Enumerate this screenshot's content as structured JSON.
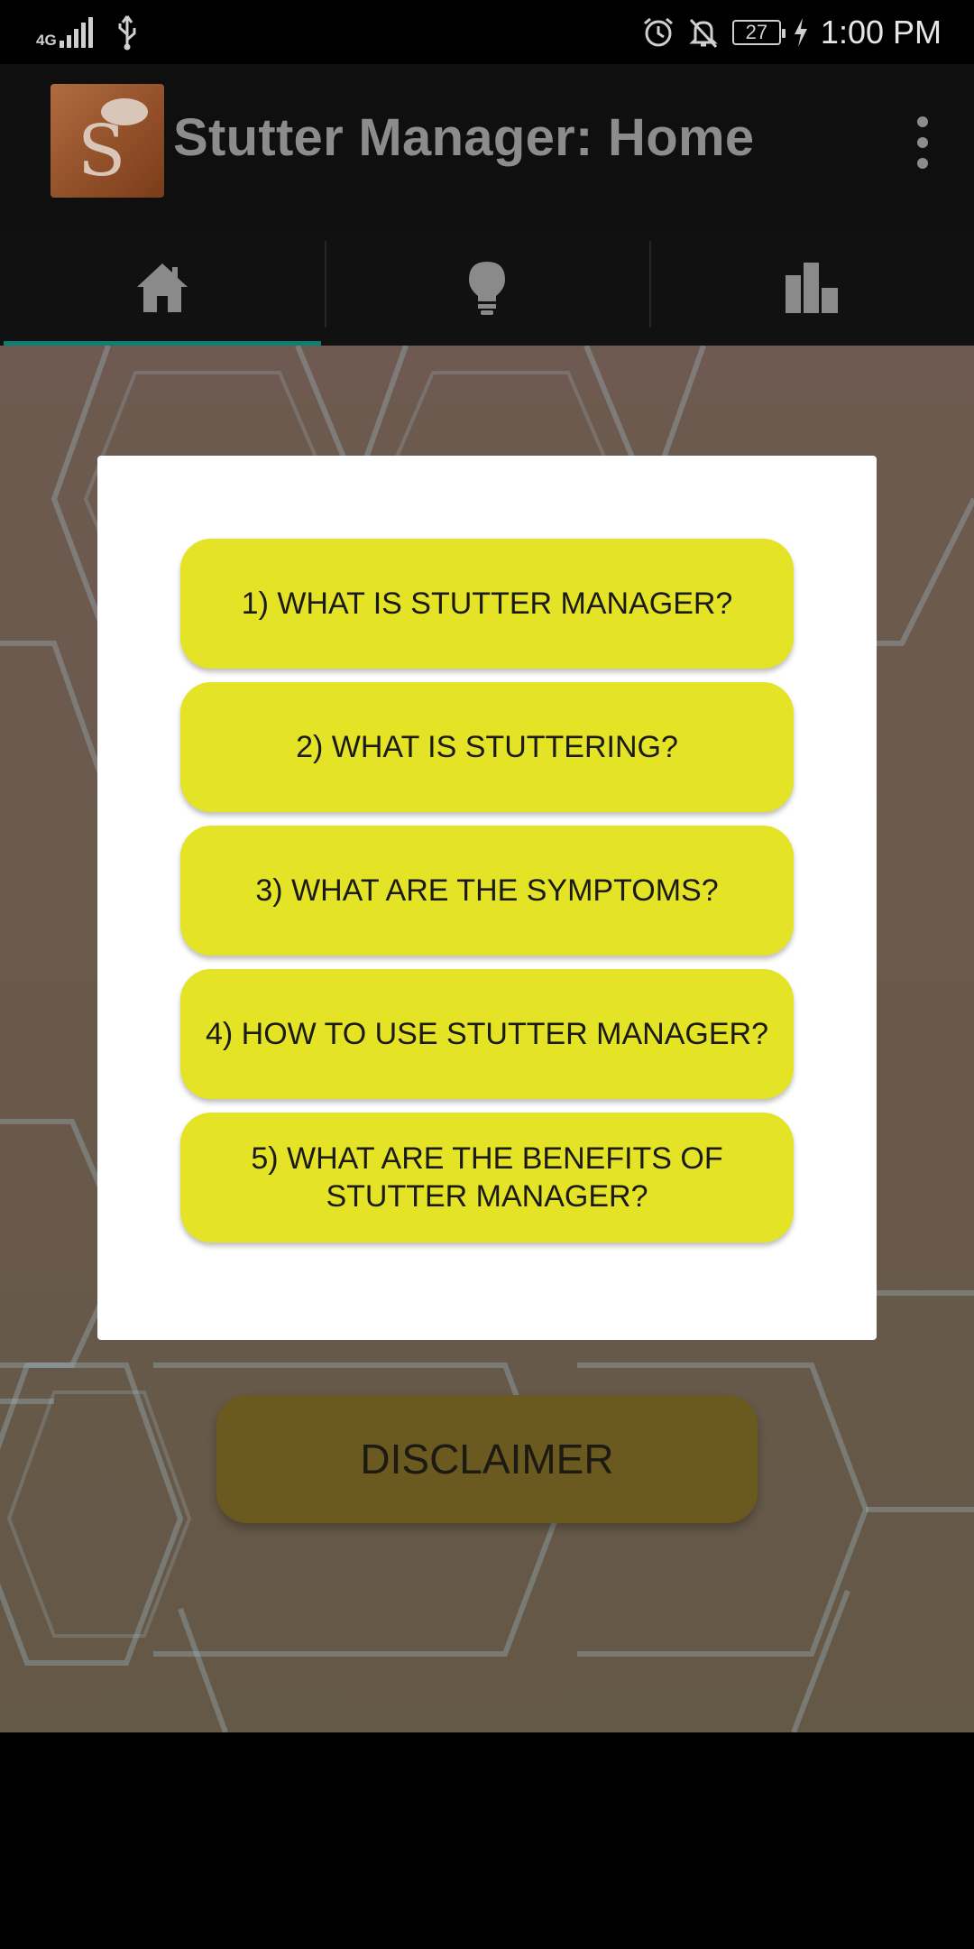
{
  "status_bar": {
    "network": "4G",
    "battery": "27",
    "time": "1:00 PM",
    "icons": [
      "signal-icon",
      "usb-icon",
      "alarm-icon",
      "bell-off-icon",
      "battery-icon",
      "charging-icon"
    ]
  },
  "app_bar": {
    "title": "Stutter Manager: Home",
    "logo_letter": "S"
  },
  "tabs": [
    {
      "icon": "home-icon",
      "active": true
    },
    {
      "icon": "lightbulb-icon",
      "active": false
    },
    {
      "icon": "bar-chart-icon",
      "active": false
    }
  ],
  "dialog": {
    "buttons": [
      "1) WHAT IS STUTTER MANAGER?",
      "2) WHAT IS STUTTERING?",
      "3) WHAT ARE THE SYMPTOMS?",
      "4) HOW TO USE STUTTER MANAGER?",
      "5) WHAT ARE THE BENEFITS OF STUTTER MANAGER?"
    ]
  },
  "main": {
    "disclaimer_label": "DISCLAIMER"
  },
  "colors": {
    "accent": "#0e7f73",
    "button_yellow": "#e4e325",
    "dim_button": "#6b5a1f"
  }
}
